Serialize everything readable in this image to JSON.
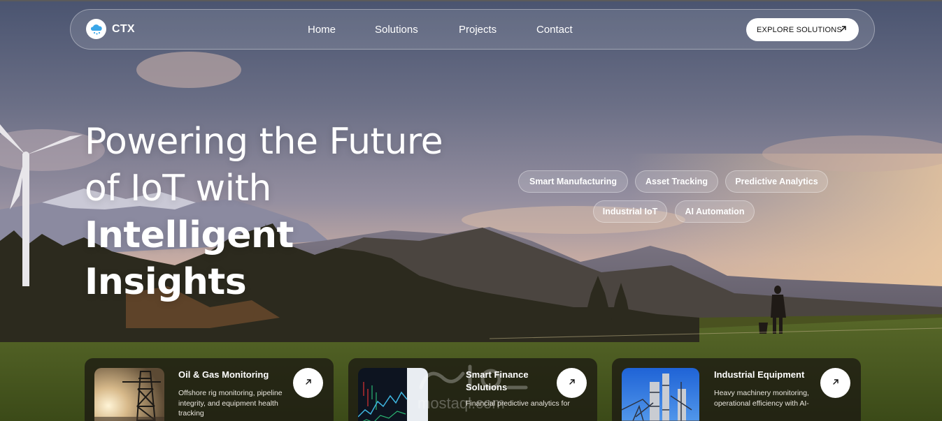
{
  "brand": {
    "name": "CTX",
    "logo_icon": "cloud-rain-icon",
    "logo_color": "#3aa6e8"
  },
  "nav": {
    "links": [
      "Home",
      "Solutions",
      "Projects",
      "Contact"
    ],
    "cta_label": "EXPLORE SOLUTIONS",
    "cta_icon": "arrow-up-right-icon"
  },
  "hero": {
    "line1": "Powering the Future",
    "line2_light": "of IoT with ",
    "line2_bold": "Intelligent",
    "line3_bold": "Insights"
  },
  "tags": [
    "Smart Manufacturing",
    "Asset Tracking",
    "Predictive Analytics",
    "Industrial IoT",
    "AI Automation"
  ],
  "cards": [
    {
      "title": "Oil & Gas Monitoring",
      "description": "Offshore rig monitoring, pipeline integrity, and equipment health tracking",
      "image": "oil-rig-sunset-image",
      "button_icon": "arrow-up-right-icon"
    },
    {
      "title": "Smart Finance Solutions",
      "description": "Financial predictive analytics for",
      "image": "finance-chart-screen-image",
      "button_icon": "arrow-up-right-icon"
    },
    {
      "title": "Industrial Equipment",
      "description": "Heavy machinery monitoring, operational efficiency with AI-",
      "image": "industrial-plant-image",
      "button_icon": "arrow-up-right-icon"
    }
  ],
  "watermark": {
    "text": "mostaql.com"
  },
  "colors": {
    "card_bg": "#1c1a12",
    "accent_white": "#ffffff",
    "sky_top": "#4b5570"
  }
}
